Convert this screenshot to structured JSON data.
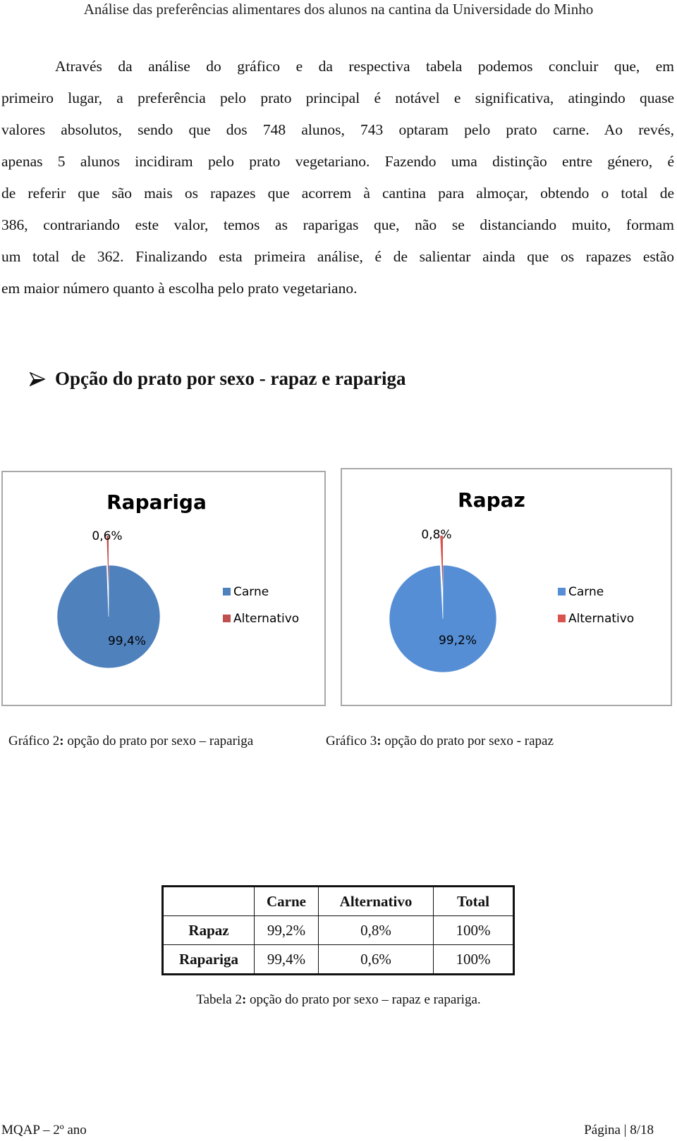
{
  "header": {
    "title": "Análise das preferências alimentares dos alunos na cantina da Universidade do Minho"
  },
  "paragraph": {
    "lines": [
      "Através da análise do gráfico e da respectiva tabela podemos concluir que, em",
      "primeiro lugar, a preferência pelo prato principal é notável e significativa, atingindo quase",
      "valores absolutos, sendo que dos 748 alunos, 743 optaram pelo prato carne. Ao revés,",
      "apenas 5 alunos incidiram pelo prato vegetariano. Fazendo uma distinção entre género, é",
      "de referir que são mais os rapazes que acorrem à cantina para almoçar, obtendo o total de",
      "386, contrariando este valor, temos as raparigas que, não se distanciando muito, formam",
      "um total de 362. Finalizando esta primeira análise, é de salientar ainda que os rapazes estão",
      "em maior número quanto à escolha pelo prato vegetariano."
    ]
  },
  "section": {
    "bullet_icon": "arrowhead-bullet-icon",
    "title": "Opção do prato por sexo - rapaz e rapariga"
  },
  "chart_data": [
    {
      "type": "pie",
      "title": "Rapariga",
      "categories": [
        "Carne",
        "Alternativo"
      ],
      "values": [
        99.4,
        0.6
      ],
      "labels": [
        "99,4%",
        "0,6%"
      ],
      "colors": [
        "#4f81bd",
        "#c0504d"
      ],
      "legend": "right",
      "legend_entries": [
        "Carne",
        "Alternativo"
      ]
    },
    {
      "type": "pie",
      "title": "Rapaz",
      "categories": [
        "Carne",
        "Alternativo"
      ],
      "values": [
        99.2,
        0.8
      ],
      "labels": [
        "99,2%",
        "0,8%"
      ],
      "colors": [
        "#558ed5",
        "#d9534f"
      ],
      "legend": "right",
      "legend_entries": [
        "Carne",
        "Alternativo"
      ]
    }
  ],
  "captions": {
    "chart2": {
      "prefix": "Gráfico 2",
      "sep": ":",
      "text": " opção do prato por sexo – rapariga"
    },
    "chart3": {
      "prefix": "Gráfico 3",
      "sep": ":",
      "text": " opção do prato por sexo - rapaz"
    }
  },
  "table": {
    "headers": [
      "",
      "Carne",
      "Alternativo",
      "Total"
    ],
    "rows": [
      {
        "label": "Rapaz",
        "cells": [
          "99,2%",
          "0,8%",
          "100%"
        ]
      },
      {
        "label": "Rapariga",
        "cells": [
          "99,4%",
          "0,6%",
          "100%"
        ]
      }
    ],
    "caption": {
      "prefix": "Tabela 2",
      "sep": ":",
      "text": " opção do prato por sexo – rapaz e rapariga."
    }
  },
  "footer": {
    "left": "MQAP – 2º ano",
    "right": "Página | 8/18"
  }
}
